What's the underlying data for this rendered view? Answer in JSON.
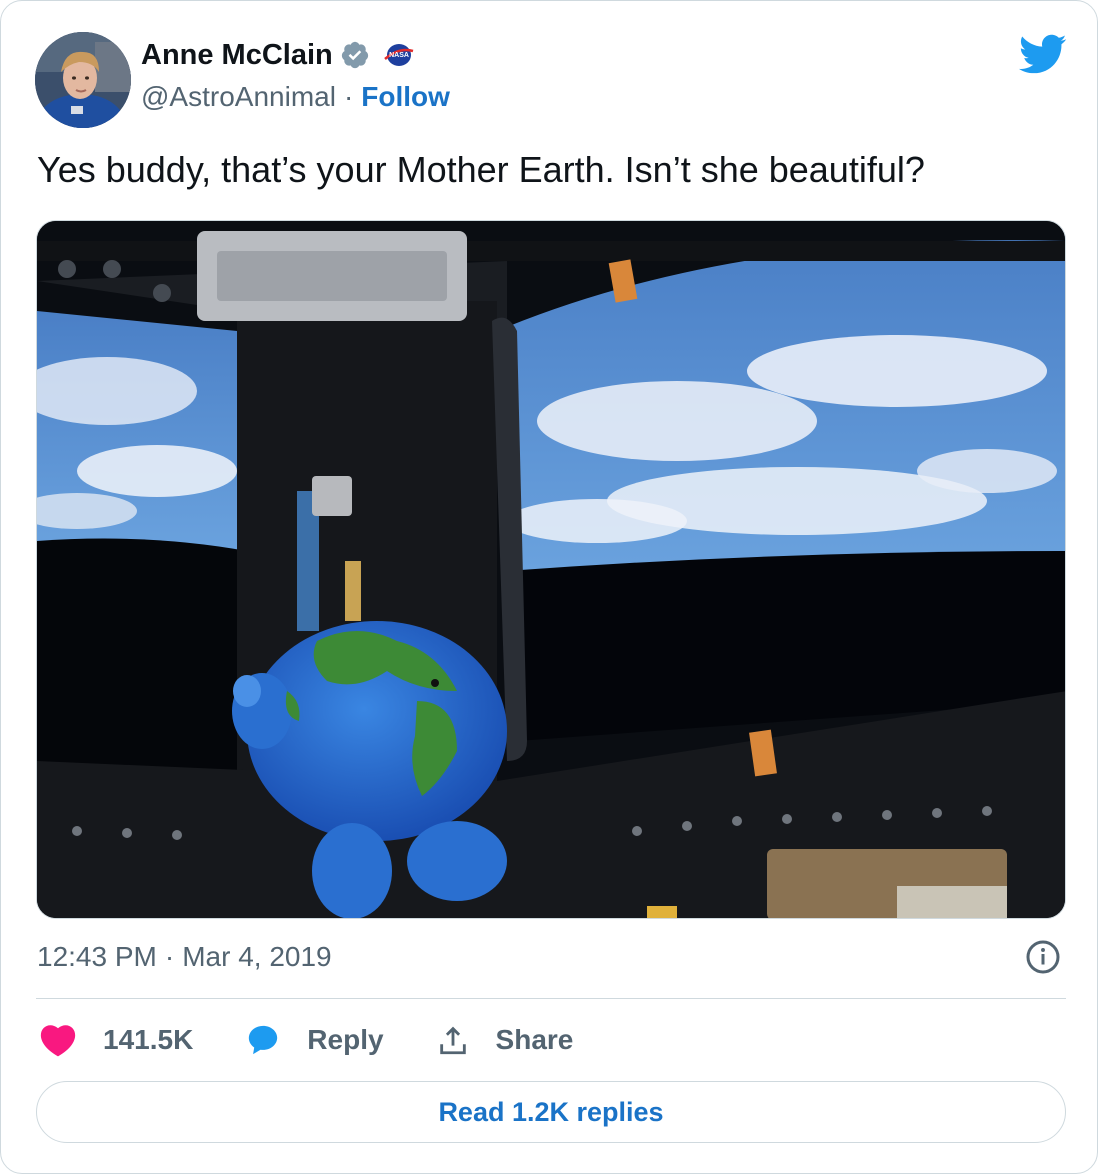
{
  "author": {
    "name": "Anne McClain",
    "handle": "@AstroAnnimal",
    "separator": "·",
    "follow_label": "Follow",
    "verified_icon": "verified-badge-icon",
    "affiliate_badge": "nasa-logo",
    "affiliate_badge_text": "NASA"
  },
  "tweet": {
    "text": "Yes buddy, that’s your Mother Earth. Isn’t she beautiful?",
    "time": "12:43 PM",
    "date_separator": "·",
    "date": "Mar 4, 2019"
  },
  "actions": {
    "likes": "141.5K",
    "reply_label": "Reply",
    "share_label": "Share"
  },
  "footer": {
    "read_replies_label": "Read 1.2K replies"
  },
  "colors": {
    "accent": "#1d9bf0",
    "link": "#1a73c7",
    "like": "#f91880",
    "text": "#0f1419",
    "secondary": "#536471",
    "border": "#cfd9de"
  }
}
